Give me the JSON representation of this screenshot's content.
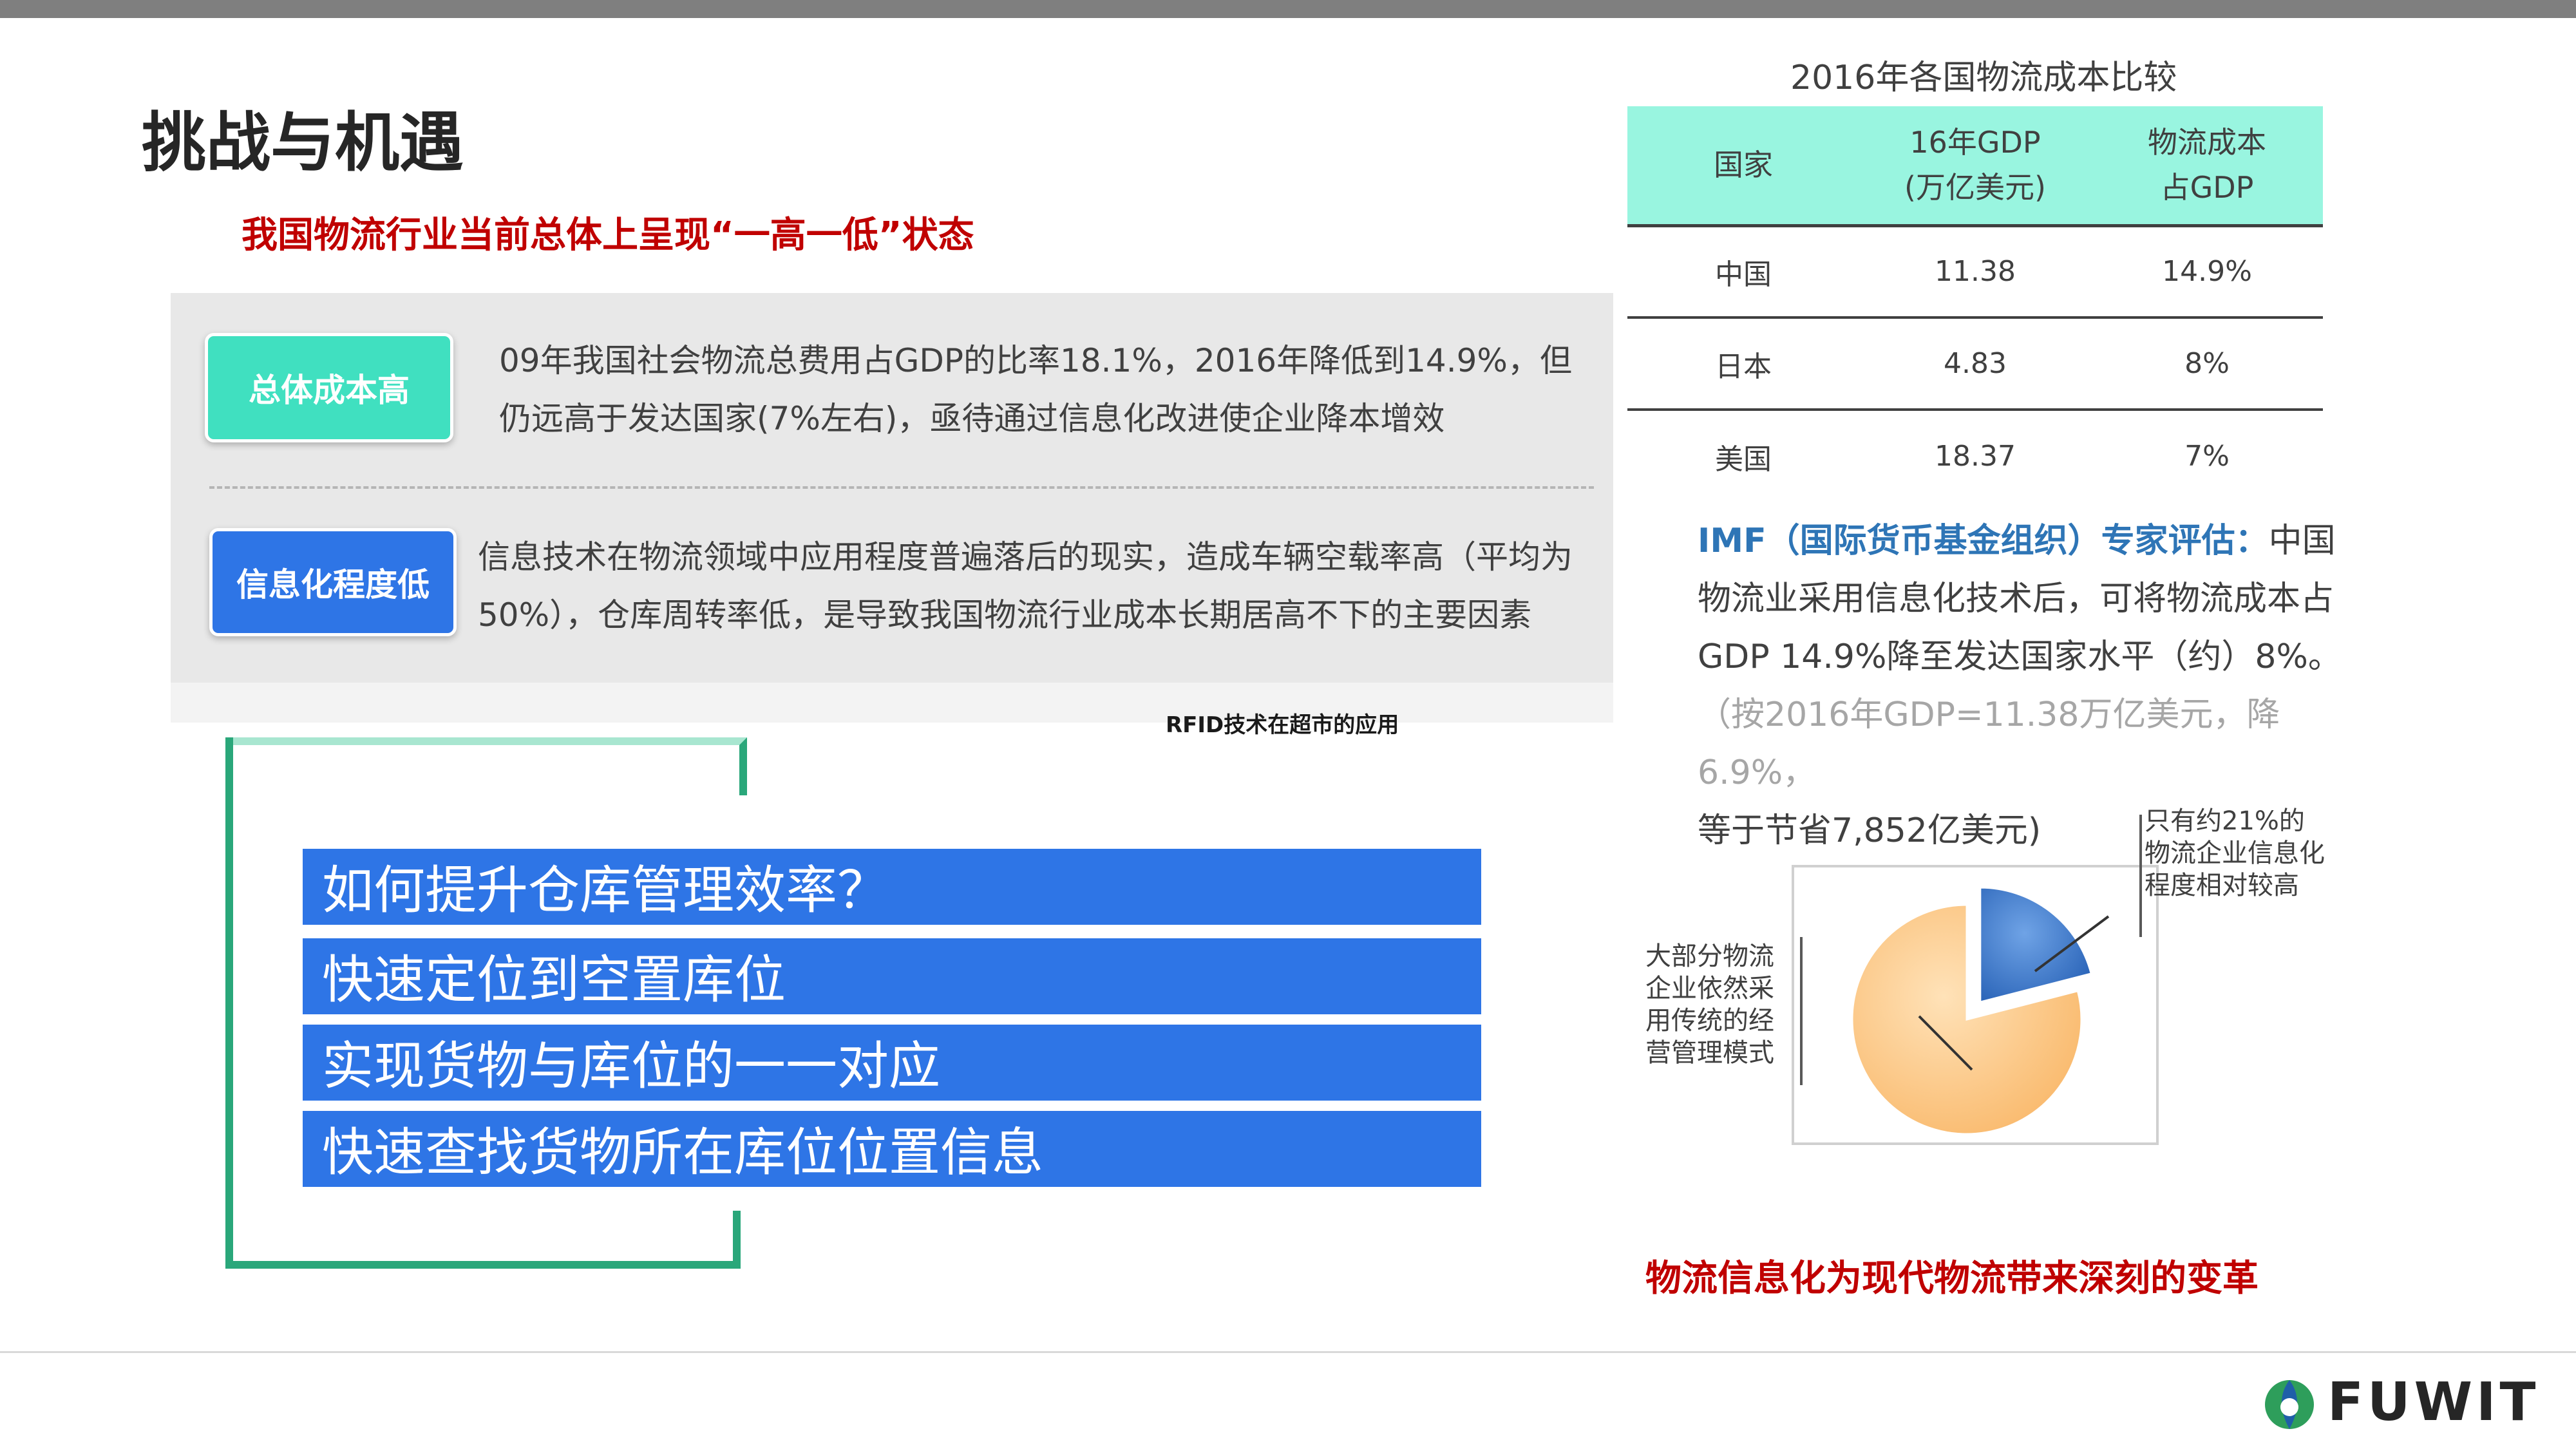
{
  "page": {
    "title": "挑战与机遇",
    "subtitle": "我国物流行业当前总体上呈现“一高一低”状态"
  },
  "challenges": [
    {
      "tag": "总体成本高",
      "text": "09年我国社会物流总费用占GDP的比率18.1%，2016年降低到14.9%，但仍远高于发达国家(7%左右)，亟待通过信息化改进使企业降本增效"
    },
    {
      "tag": "信息化程度低",
      "text": "信息技术在物流领域中应用程度普遍落后的现实，造成车辆空载率高（平均为50%），仓库周转率低，是导致我国物流行业成本长期居高不下的主要因素"
    }
  ],
  "rfid_caption": "RFID技术在超市的应用",
  "questions": [
    "如何提升仓库管理效率？",
    "快速定位到空置库位",
    "实现货物与库位的一一对应",
    "快速查找货物所在库位位置信息"
  ],
  "table": {
    "title": "2016年各国物流成本比较",
    "headers": [
      "国家",
      "16年GDP\n(万亿美元)",
      "物流成本\n占GDP"
    ],
    "rows": [
      [
        "中国",
        "11.38",
        "14.9%"
      ],
      [
        "日本",
        "4.83",
        "8%"
      ],
      [
        "美国",
        "18.37",
        "7%"
      ]
    ]
  },
  "imf": {
    "head": "IMF（国际货币基金组织）专家评估：",
    "body": "中国物流业采用信息化技术后，可将物流成本占GDP 14.9%降至发达国家水平（约）8%。",
    "note": "（按2016年GDP=11.38万亿美元，降6.9%，",
    "note_end": "等于节省7,852亿美元)"
  },
  "chart_data": {
    "type": "pie",
    "values": [
      79,
      21
    ],
    "labels": [
      "大部分物流企业依然采用传统的经营管理模式",
      "只有约21%的物流企业信息化程度相对较高"
    ],
    "colors": [
      "#fdc98a",
      "#3a78c9"
    ],
    "exploded": [
      false,
      true
    ]
  },
  "bottom_statement": "物流信息化为现代物流带来深刻的变革",
  "logo": {
    "text": "FUWIT",
    "icon": "fuwit-logo-icon"
  }
}
